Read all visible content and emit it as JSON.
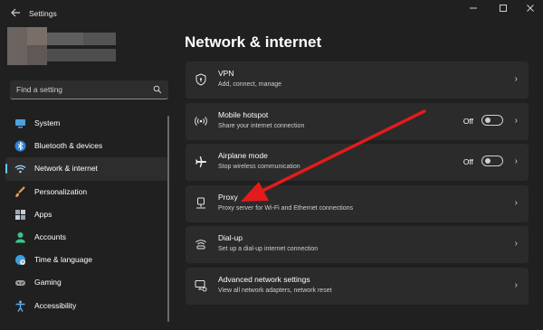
{
  "window": {
    "title": "Settings",
    "back_icon": "arrow-left-icon",
    "controls": [
      "minimize-icon",
      "maximize-icon",
      "close-icon"
    ]
  },
  "search": {
    "placeholder": "Find a setting",
    "icon": "search-icon"
  },
  "sidebar": {
    "items": [
      {
        "label": "System",
        "icon": "monitor-icon",
        "color": "#4aa3df"
      },
      {
        "label": "Bluetooth & devices",
        "icon": "bluetooth-icon",
        "color": "#2f7fd8"
      },
      {
        "label": "Network & internet",
        "icon": "wifi-icon",
        "color": "#9ecbf0",
        "selected": true
      },
      {
        "label": "Personalization",
        "icon": "paintbrush-icon",
        "color": "#e5a25a"
      },
      {
        "label": "Apps",
        "icon": "apps-icon",
        "color": "#9aa7b3"
      },
      {
        "label": "Accounts",
        "icon": "person-icon",
        "color": "#3cc488"
      },
      {
        "label": "Time & language",
        "icon": "globe-clock-icon",
        "color": "#3aa0e0"
      },
      {
        "label": "Gaming",
        "icon": "gamepad-icon",
        "color": "#9a9a9a"
      },
      {
        "label": "Accessibility",
        "icon": "accessibility-icon",
        "color": "#5aaef0"
      }
    ],
    "accent": "#60cdff"
  },
  "main": {
    "title": "Network & internet",
    "cards": [
      {
        "title": "VPN",
        "subtitle": "Add, connect, manage",
        "icon": "shield-icon"
      },
      {
        "title": "Mobile hotspot",
        "subtitle": "Share your internet connection",
        "icon": "hotspot-icon",
        "state": "Off",
        "toggle": false
      },
      {
        "title": "Airplane mode",
        "subtitle": "Stop wireless communication",
        "icon": "airplane-icon",
        "state": "Off",
        "toggle": false
      },
      {
        "title": "Proxy",
        "subtitle": "Proxy server for Wi-Fi and Ethernet connections",
        "icon": "proxy-icon"
      },
      {
        "title": "Dial-up",
        "subtitle": "Set up a dial-up internet connection",
        "icon": "dialup-icon"
      },
      {
        "title": "Advanced network settings",
        "subtitle": "View all network adapters, network reset",
        "icon": "network-adapter-icon"
      }
    ]
  },
  "annotation": {
    "color": "#e31b1b"
  }
}
